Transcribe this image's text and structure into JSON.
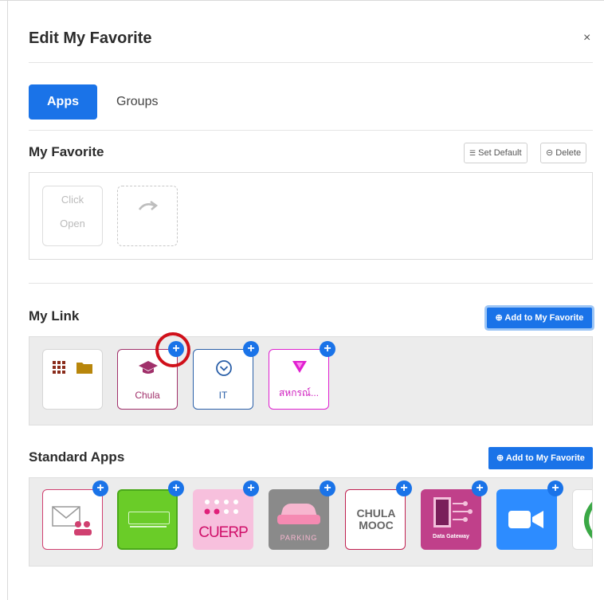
{
  "modal": {
    "title": "Edit My Favorite",
    "close_label": "×"
  },
  "tabs": [
    {
      "label": "Apps",
      "active": true
    },
    {
      "label": "Groups",
      "active": false
    }
  ],
  "my_favorite": {
    "title": "My Favorite",
    "set_default_label": "Set Default",
    "delete_label": "Delete",
    "click_open_line1": "Click",
    "click_open_line2": "Open"
  },
  "my_link": {
    "title": "My Link",
    "add_label": "Add to My Favorite",
    "items": [
      {
        "label": "Chula",
        "icon": "graduation-cap-icon"
      },
      {
        "label": "IT",
        "icon": "chevron-circle-icon"
      },
      {
        "label": "สหกรณ์...",
        "icon": "triangle-icon"
      }
    ]
  },
  "standard_apps": {
    "title": "Standard Apps",
    "add_label": "Add to My Favorite",
    "apps": [
      {
        "name": "mail-app",
        "caption": ""
      },
      {
        "name": "lib-app",
        "caption": ""
      },
      {
        "name": "cuerp-app",
        "caption": "CUERP"
      },
      {
        "name": "parking-app",
        "caption": "PARKING"
      },
      {
        "name": "mooc-app",
        "caption": "CHULA MOOC"
      },
      {
        "name": "data-gateway-app",
        "caption": "Data Gateway"
      },
      {
        "name": "zoom-app",
        "caption": ""
      }
    ]
  },
  "colors": {
    "accent": "#1a73e8",
    "chula": "#a0306a",
    "it": "#2a5fa8",
    "coop": "#e020d0",
    "highlight": "#d0101a"
  }
}
